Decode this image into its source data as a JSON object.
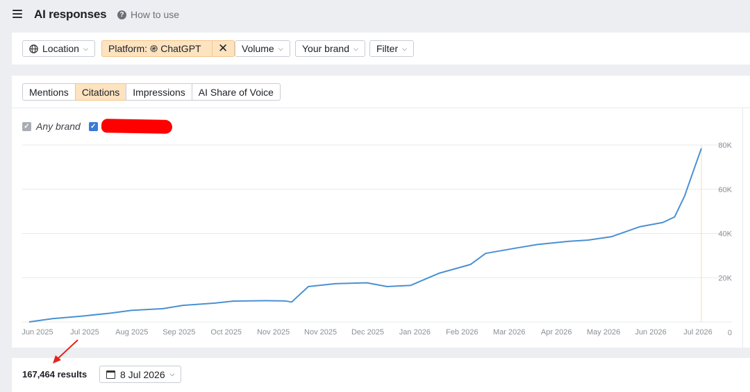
{
  "header": {
    "title": "AI responses",
    "help_label": "How to use"
  },
  "filters": {
    "location": "Location",
    "platform": "Platform: ֎ ChatGPT",
    "volume": "Volume",
    "brand": "Your brand",
    "filter": "Filter"
  },
  "tabs": [
    {
      "label": "Mentions",
      "active": false
    },
    {
      "label": "Citations",
      "active": true
    },
    {
      "label": "Impressions",
      "active": false
    },
    {
      "label": "AI Share of Voice",
      "active": false
    }
  ],
  "legend": {
    "any_brand": "Any brand",
    "brand_redacted": true
  },
  "colors": {
    "line": "#4a90d2",
    "accent": "#fde3c0",
    "annotation_arrow": "#e3241b",
    "marker_line": "#f6deb0"
  },
  "chart_data": {
    "type": "line",
    "x_tick_labels": [
      "Jun 2025",
      "Jul 2025",
      "Aug 2025",
      "Sep 2025",
      "Oct 2025",
      "Nov 2025",
      "Nov 2025",
      "Dec 2025",
      "Jan 2026",
      "Feb 2026",
      "Mar 2026",
      "Apr 2026",
      "May 2026",
      "Jun 2026",
      "Jul 2026"
    ],
    "y_tick_labels": [
      "0",
      "20K",
      "40K",
      "60K",
      "80K"
    ],
    "ylim": [
      0,
      80000
    ],
    "xlim": [
      "2025-06-01",
      "2026-07-08"
    ],
    "grid": true,
    "series": [
      {
        "x": [
          "2025-06-01",
          "2025-06-15",
          "2025-07-01",
          "2025-07-20",
          "2025-08-01",
          "2025-08-20",
          "2025-09-01",
          "2025-09-20",
          "2025-10-01",
          "2025-10-20",
          "2025-11-01",
          "2025-11-05",
          "2025-11-15",
          "2025-12-01",
          "2025-12-20",
          "2026-01-01",
          "2026-01-15",
          "2026-02-01",
          "2026-02-20",
          "2026-03-01",
          "2026-03-20",
          "2026-04-01",
          "2026-04-20",
          "2026-05-01",
          "2026-05-15",
          "2026-06-01",
          "2026-06-15",
          "2026-06-22",
          "2026-06-28",
          "2026-07-04",
          "2026-07-08"
        ],
        "values": [
          0,
          1500,
          2500,
          4000,
          5200,
          6000,
          7500,
          8500,
          9400,
          9600,
          9500,
          9000,
          16000,
          17300,
          17700,
          16000,
          16500,
          22000,
          26000,
          31000,
          33500,
          35000,
          36500,
          37000,
          38500,
          43000,
          45000,
          47500,
          57000,
          70000,
          78500
        ]
      }
    ]
  },
  "footer": {
    "results": "167,464 results",
    "date": "8 Jul 2026"
  }
}
